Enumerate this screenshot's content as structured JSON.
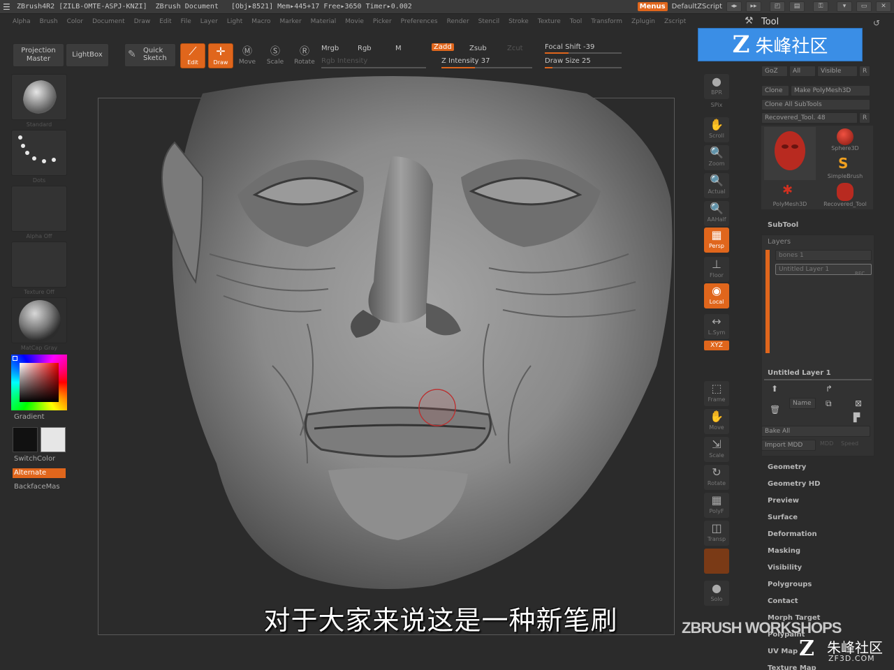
{
  "titlebar": {
    "app": "ZBrush4R2",
    "serial": "[ZILB-OMTE-ASPJ-KNZI]",
    "document": "ZBrush Document",
    "obj": "[Obj▸8521] Mem▸445+17 Free▸3650 Timer▸0.002",
    "menus": "Menus",
    "script": "DefaultZScript"
  },
  "menubar": [
    "Alpha",
    "Brush",
    "Color",
    "Document",
    "Draw",
    "Edit",
    "File",
    "Layer",
    "Light",
    "Macro",
    "Marker",
    "Material",
    "Movie",
    "Picker",
    "Preferences",
    "Render",
    "Stencil",
    "Stroke",
    "Texture",
    "Tool",
    "Transform",
    "Zplugin",
    "Zscript"
  ],
  "shelf": {
    "projection_master": "Projection\nMaster",
    "lightbox": "LightBox",
    "quick_sketch": "Quick\nSketch",
    "edit": "Edit",
    "draw": "Draw",
    "move": "Move",
    "scale": "Scale",
    "rotate": "Rotate",
    "mrgb": "Mrgb",
    "rgb": "Rgb",
    "m": "M",
    "zadd": "Zadd",
    "zsub": "Zsub",
    "zcut": "Zcut",
    "rgb_intensity": "Rgb Intensity",
    "z_intensity": "Z Intensity 37",
    "focal_shift": "Focal Shift -39",
    "draw_size": "Draw Size 25",
    "z_intensity_value": 37,
    "focal_shift_value": -39,
    "draw_size_value": 25
  },
  "left": {
    "standard": "Standard",
    "dots": "Dots",
    "alpha_off": "Alpha Off",
    "texture_off": "Texture Off",
    "matcap": "MatCap Gray",
    "gradient": "Gradient",
    "switchcolor": "SwitchColor",
    "alternate": "Alternate",
    "backface": "BackfaceMas"
  },
  "right_tools": [
    {
      "label": "BPR",
      "icon": "●"
    },
    {
      "label": "SPix",
      "icon": ""
    },
    {
      "label": "Scroll",
      "icon": "✋"
    },
    {
      "label": "Zoom",
      "icon": "🔍"
    },
    {
      "label": "Actual",
      "icon": "🔍"
    },
    {
      "label": "AAHalf",
      "icon": "🔍"
    },
    {
      "label": "Persp",
      "icon": "▦"
    },
    {
      "label": "Floor",
      "icon": "⊥"
    },
    {
      "label": "Local",
      "icon": "◉"
    },
    {
      "label": "L.Sym",
      "icon": "↔"
    },
    {
      "label": "Frame",
      "icon": "⬚"
    },
    {
      "label": "Move",
      "icon": "✋"
    },
    {
      "label": "Scale",
      "icon": "⇲"
    },
    {
      "label": "Rotate",
      "icon": "↻"
    },
    {
      "label": "PolyF",
      "icon": "▦"
    },
    {
      "label": "Transp",
      "icon": "◫"
    },
    {
      "label": "Solo",
      "icon": "●"
    }
  ],
  "right_xyz": "XYZ",
  "tool": {
    "title": "Tool",
    "goz": "GoZ",
    "all": "All",
    "visible": "Visible",
    "r": "R",
    "clone": "Clone",
    "make_polymesh": "Make PolyMesh3D",
    "clone_all": "Clone All SubTools",
    "current": "Recovered_Tool. 48",
    "sphere3d": "Sphere3D",
    "simplebrush": "SimpleBrush",
    "polymesh3d": "PolyMesh3D",
    "recovered": "Recovered_Tool",
    "subtool": "SubTool",
    "layers": "Layers",
    "layer_bones": "bones 1",
    "layer_untitled": "Untitled Layer 1",
    "layer_rec": "REC",
    "untitled_layer": "Untitled Layer 1",
    "name": "Name",
    "bake_all": "Bake All",
    "import_mdd": "Import MDD",
    "mdd": "MDD",
    "speed": "Speed",
    "sections": [
      "Geometry",
      "Geometry HD",
      "Preview",
      "Surface",
      "Deformation",
      "Masking",
      "Visibility",
      "Polygroups",
      "Contact",
      "Morph Target",
      "Polypaint",
      "UV Map",
      "Texture Map"
    ]
  },
  "watermark": {
    "top_text": "朱峰社区",
    "top_logo": "Z",
    "brand": "ZBRUSH WORKSHOPS",
    "zf_logo": "Z",
    "zf_text": "朱峰社区",
    "zf_url": "ZF3D.COM"
  },
  "subtitle": "对于大家来说这是一种新笔刷",
  "colors": {
    "accent": "#e0661c",
    "panel": "#3c3c3c",
    "bg": "#2b2b2b"
  }
}
